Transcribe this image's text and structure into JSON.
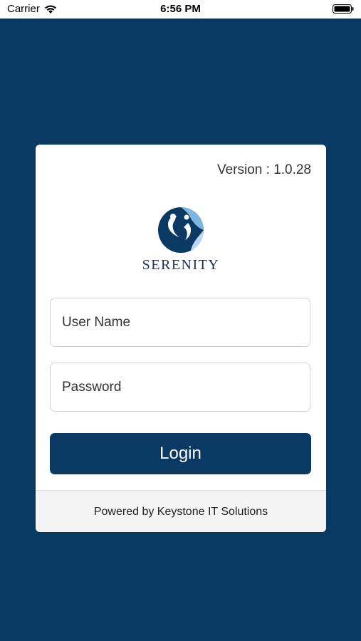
{
  "status_bar": {
    "carrier": "Carrier",
    "time": "6:56 PM"
  },
  "card": {
    "version": "Version : 1.0.28",
    "logo_text": "SERENITY",
    "username": {
      "value": "",
      "placeholder": "User Name"
    },
    "password": {
      "value": "",
      "placeholder": "Password"
    },
    "login_label": "Login",
    "footer_text": "Powered by Keystone IT Solutions"
  },
  "colors": {
    "background": "#0a3a63",
    "button": "#0a3a63",
    "logo_dark": "#0a3a63",
    "logo_light": "#7fb6e0"
  }
}
